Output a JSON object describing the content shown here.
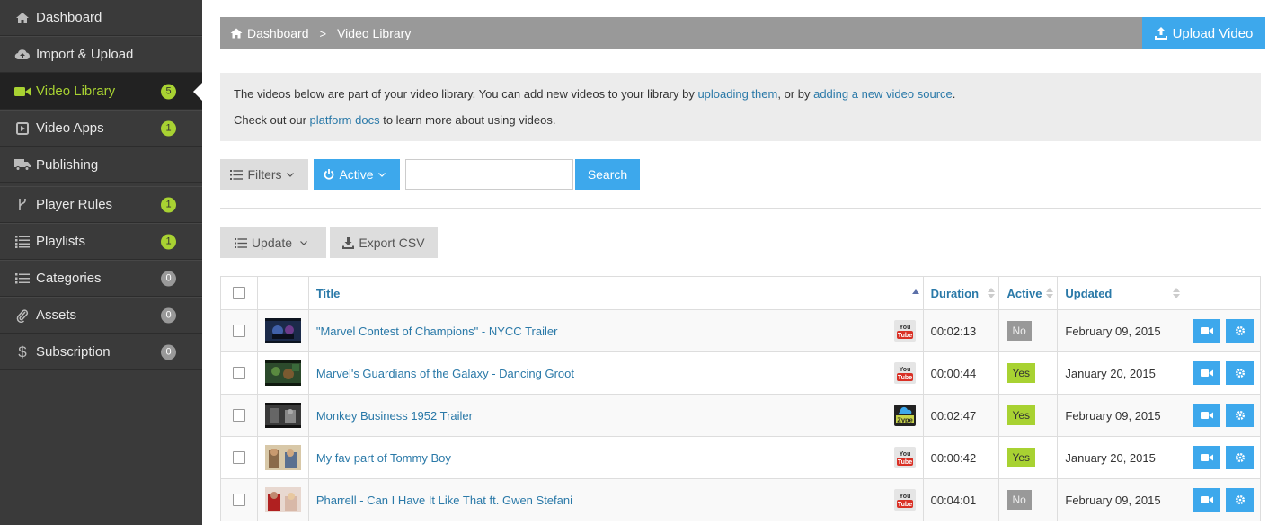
{
  "sidebar": {
    "items": [
      {
        "label": "Dashboard",
        "badge": null
      },
      {
        "label": "Import & Upload",
        "badge": null
      },
      {
        "label": "Video Library",
        "badge": "5",
        "active": true
      },
      {
        "label": "Video Apps",
        "badge": "1"
      },
      {
        "label": "Publishing",
        "badge": null
      },
      {
        "label": "Player Rules",
        "badge": "1"
      },
      {
        "label": "Playlists",
        "badge": "1"
      },
      {
        "label": "Categories",
        "badge": "0"
      },
      {
        "label": "Assets",
        "badge": "0"
      },
      {
        "label": "Subscription",
        "badge": "0"
      }
    ]
  },
  "breadcrumb": {
    "home": "Dashboard",
    "separator": ">",
    "current": "Video Library"
  },
  "upload_label": "Upload Video",
  "info": {
    "line1_before": "The videos below are part of your video library. You can add new videos to your library by ",
    "line1_link1": "uploading them",
    "line1_mid": ", or by ",
    "line1_link2": "adding a new video source",
    "line1_after": ".",
    "line2_before": "Check out our ",
    "line2_link": "platform docs",
    "line2_after": " to learn more about using videos."
  },
  "filters": {
    "filters_label": "Filters",
    "active_label": "Active",
    "search_value": "",
    "search_label": "Search"
  },
  "actions": {
    "update_label": "Update",
    "export_label": "Export CSV"
  },
  "table": {
    "headers": {
      "title": "Title",
      "duration": "Duration",
      "active": "Active",
      "updated": "Updated"
    },
    "rows": [
      {
        "title": "\"Marvel Contest of Champions\" - NYCC Trailer",
        "source": "youtube",
        "duration": "00:02:13",
        "active": "No",
        "updated": "February 09, 2015"
      },
      {
        "title": "Marvel's Guardians of the Galaxy - Dancing Groot",
        "source": "youtube",
        "duration": "00:00:44",
        "active": "Yes",
        "updated": "January 20, 2015"
      },
      {
        "title": "Monkey Business 1952 Trailer",
        "source": "zype",
        "duration": "00:02:47",
        "active": "Yes",
        "updated": "February 09, 2015"
      },
      {
        "title": "My fav part of Tommy Boy",
        "source": "youtube",
        "duration": "00:00:42",
        "active": "Yes",
        "updated": "January 20, 2015"
      },
      {
        "title": "Pharrell - Can I Have It Like That ft. Gwen Stefani",
        "source": "youtube",
        "duration": "00:04:01",
        "active": "No",
        "updated": "February 09, 2015"
      }
    ]
  },
  "source_icons": {
    "youtube": {
      "top": "You",
      "bottom": "Tube"
    },
    "zype": {
      "label": "Zype"
    }
  },
  "colors": {
    "accent_blue": "#3da8ec",
    "active_green": "#a8d232",
    "sidebar_bg": "#3a3a3a",
    "link": "#2a79a8"
  }
}
